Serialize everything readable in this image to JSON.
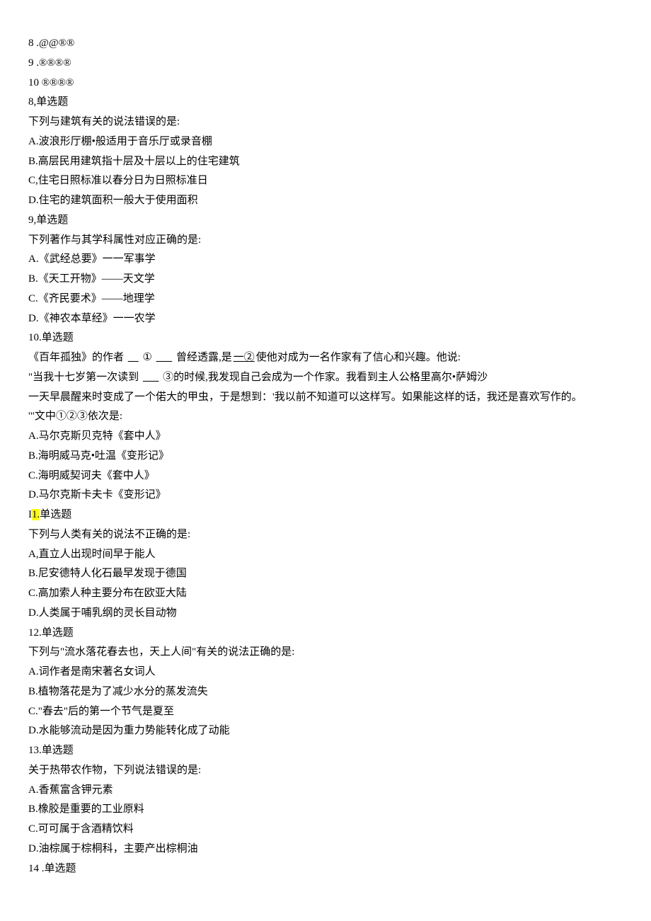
{
  "l1": "8 .@@®®",
  "l2": "9 .®®®®",
  "l3": "10 ®®®®",
  "l4": "8,单选题",
  "l5": "下列与建筑有关的说法错误的是:",
  "l6": "A.波浪形厅棚•般适用于音乐厅或录音棚",
  "l7": "B.高层民用建筑指十层及十层以上的住宅建筑",
  "l8": "C,住宅日照标准以春分日为日照标准日",
  "l9": "D.住宅的建筑面积一般大于使用面积",
  "l10": "9,单选题",
  "l11": "下列著作与其学科属性对应正确的是:",
  "l12": "A.《武经总要》一一军事学",
  "l13": "B.《天工开物》——天文学",
  "l14": "C.《齐民要术》——地理学",
  "l15": "D.《神农本草经》一一农学",
  "l16": "10.单选题",
  "l17a": "《百年孤独》的作者",
  "l17b": "①",
  "l17c": "曾经透露,是",
  "l17d": "一②",
  "l17e": "使他对成为一名作家有了信心和兴趣。他说:",
  "l18a": "\"当我十七岁第一次读到",
  "l18b": "③的时候,我发现自己会成为一个作家。我看到主人公格里高尔•萨姆沙",
  "l19": "一天早晨醒来时变成了一个偌大的甲虫，于是想到：'我以前不知道可以这样写。如果能这样的话，我还是喜欢写作的。",
  "l20": "'\"文中①②③依次是:",
  "l21": "A.马尔克斯贝克特《套中人》",
  "l22": "B.海明威马克•吐温《变形记》",
  "l23": "C.海明威契诃夫《套中人》",
  "l24": "D.马尔克斯卡夫卡《变形记》",
  "l25a": "I",
  "l25b": "1.",
  "l25c": "单选题",
  "l26": "下列与人类有关的说法不正确的是:",
  "l27": "A,直立人出现时间早于能人",
  "l28": "B.尼安德特人化石最早发现于德国",
  "l29": "C.高加索人种主要分布在欧亚大陆",
  "l30": "D.人类属于哺乳纲的灵长目动物",
  "l31": "12.单选题",
  "l32": "下列与\"流水落花春去也，天上人间\"有关的说法正确的是:",
  "l33": "A.词作者是南宋著名女词人",
  "l34": "B.植物落花是为了减少水分的蒸发流失",
  "l35": "C.\"春去\"后的第一个节气是夏至",
  "l36": "D.水能够流动是因为重力势能转化成了动能",
  "l37": "13.单选题",
  "l38": "关于热带农作物，下列说法错误的是:",
  "l39": "A.香蕉富含钾元素",
  "l40": "B.橡胶是重要的工业原料",
  "l41": "C.可可属于含酒精饮料",
  "l42": "D.油棕属于棕桐科，主要产出棕桐油",
  "l43": "14 .单选题"
}
